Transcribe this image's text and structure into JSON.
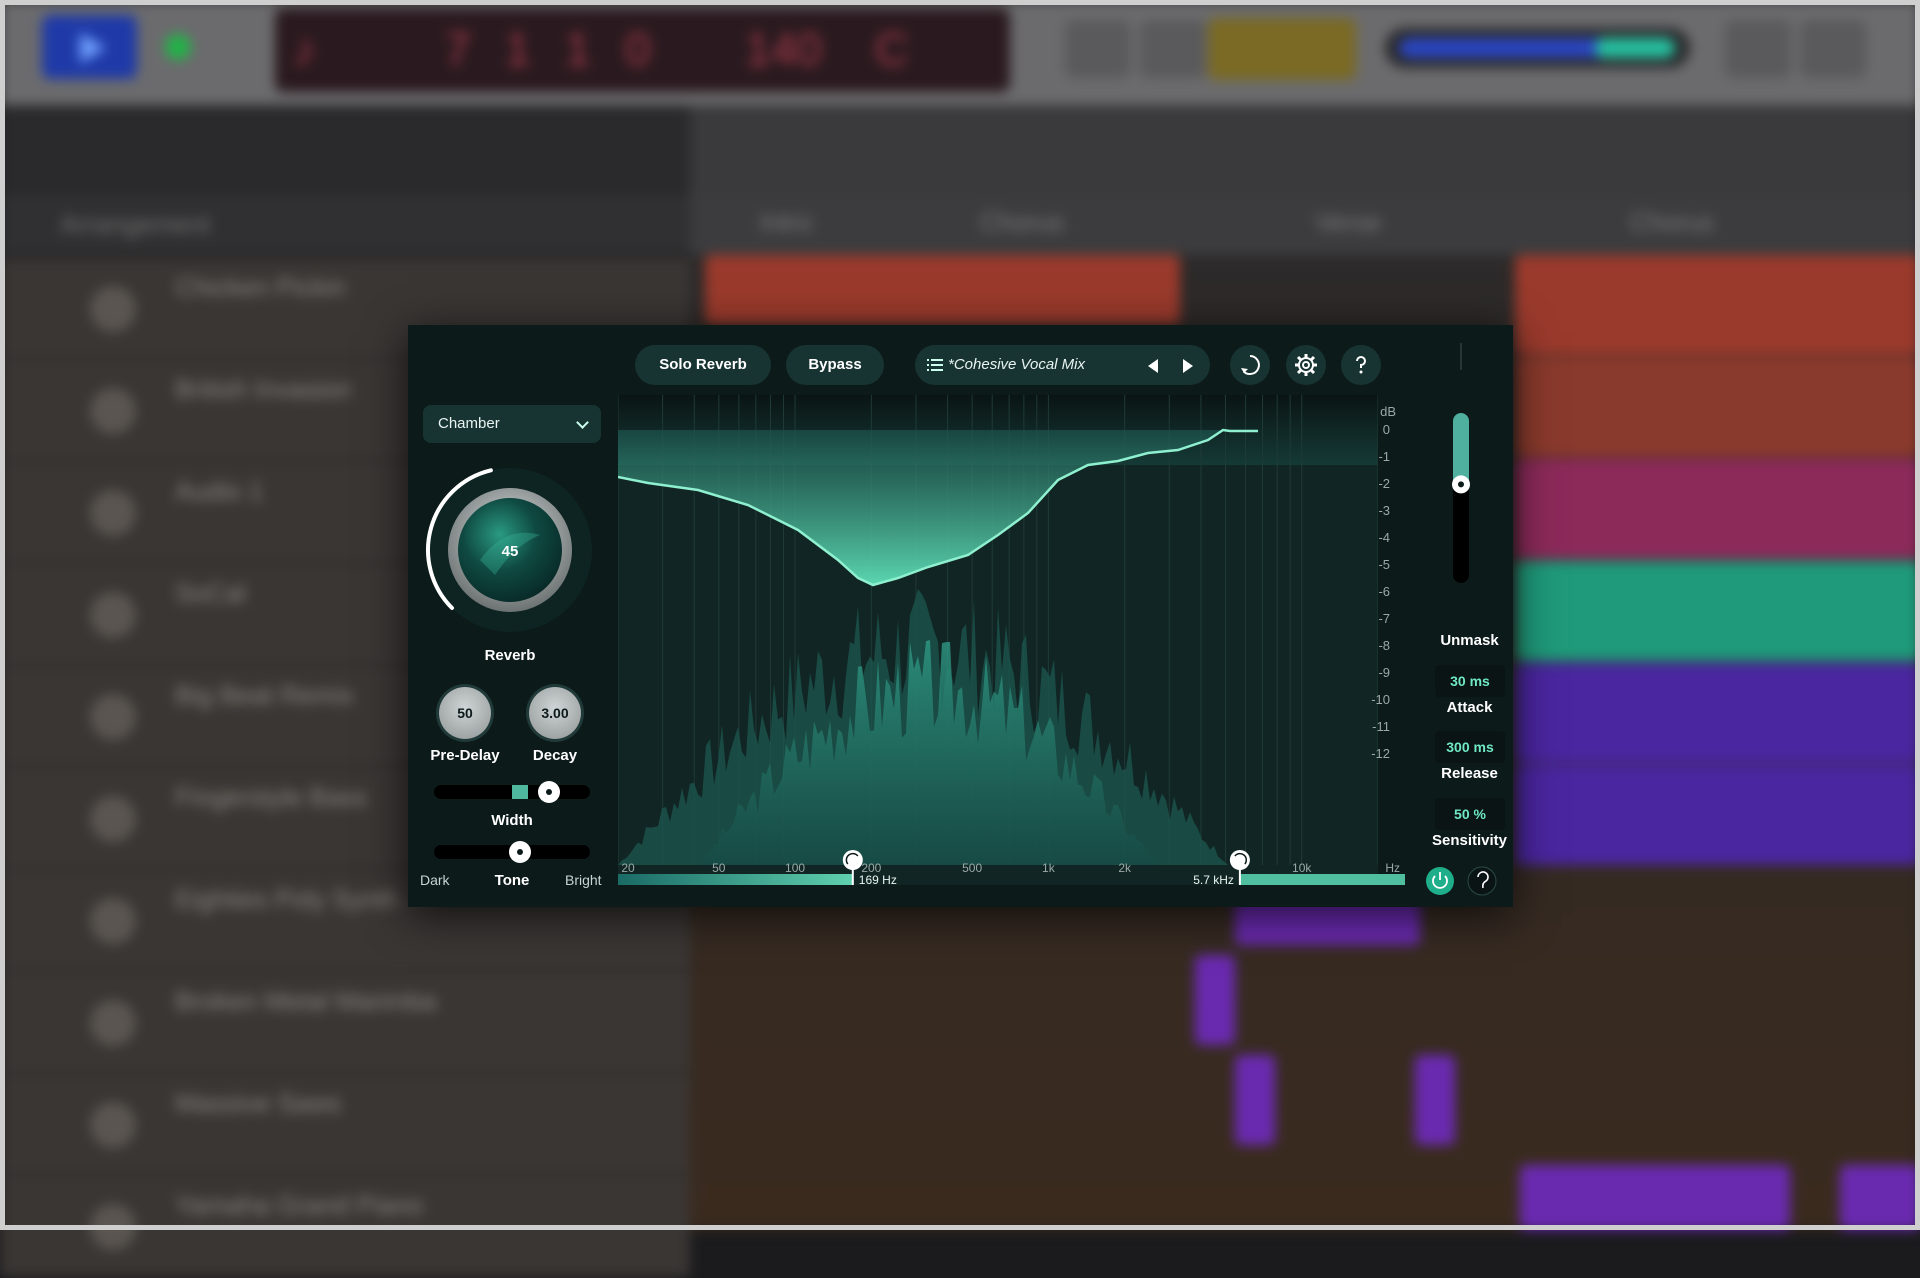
{
  "background": {
    "tracks": [
      {
        "name": "Chicken Pickin"
      },
      {
        "name": "British Invasion"
      },
      {
        "name": "Audio 1"
      },
      {
        "name": "SoCal"
      },
      {
        "name": "Big Beat Remix"
      },
      {
        "name": "Fingerstyle Bass"
      },
      {
        "name": "Eighties Poly Synth"
      },
      {
        "name": "Broken Metal Marimba"
      },
      {
        "name": "Massive Saws"
      },
      {
        "name": "Yamaha Grand Piano"
      }
    ],
    "arrangement_label": "Arrangement",
    "sections": [
      "Intro",
      "Chorus",
      "Verse",
      "Chorus"
    ]
  },
  "plugin": {
    "reverb_type": "Chamber",
    "reverb": {
      "value": "45",
      "label": "Reverb",
      "level": 0.45
    },
    "pre_delay": {
      "value": "50",
      "label": "Pre-Delay"
    },
    "decay": {
      "value": "3.00",
      "label": "Decay"
    },
    "width": {
      "label": "Width",
      "level": 0.6
    },
    "tone": {
      "label": "Tone",
      "dark": "Dark",
      "bright": "Bright",
      "level": 0.5
    },
    "solo_reverb_label": "Solo Reverb",
    "bypass_label": "Bypass",
    "preset_name": "*Cohesive Vocal Mix",
    "unmask": {
      "label": "Unmask",
      "level": 0.58
    },
    "attack": {
      "value": "30 ms",
      "label": "Attack"
    },
    "release": {
      "value": "300 ms",
      "label": "Release"
    },
    "sensitivity": {
      "value": "50 %",
      "label": "Sensitivity"
    },
    "graph": {
      "db_unit": "dB",
      "db_ticks": [
        "0",
        "-1",
        "-2",
        "-3",
        "-4",
        "-5",
        "-6",
        "-7",
        "-8",
        "-9",
        "-10",
        "-11",
        "-12"
      ],
      "freq_ticks": [
        "20",
        "50",
        "100",
        "200",
        "500",
        "1k",
        "2k",
        "10k"
      ],
      "freq_unit": "Hz",
      "low_cut": "169 Hz",
      "high_cut": "5.7 kHz"
    },
    "colors": {
      "accent": "#5fe0b8",
      "panel": "#0d1a1a",
      "button": "#173433"
    }
  }
}
